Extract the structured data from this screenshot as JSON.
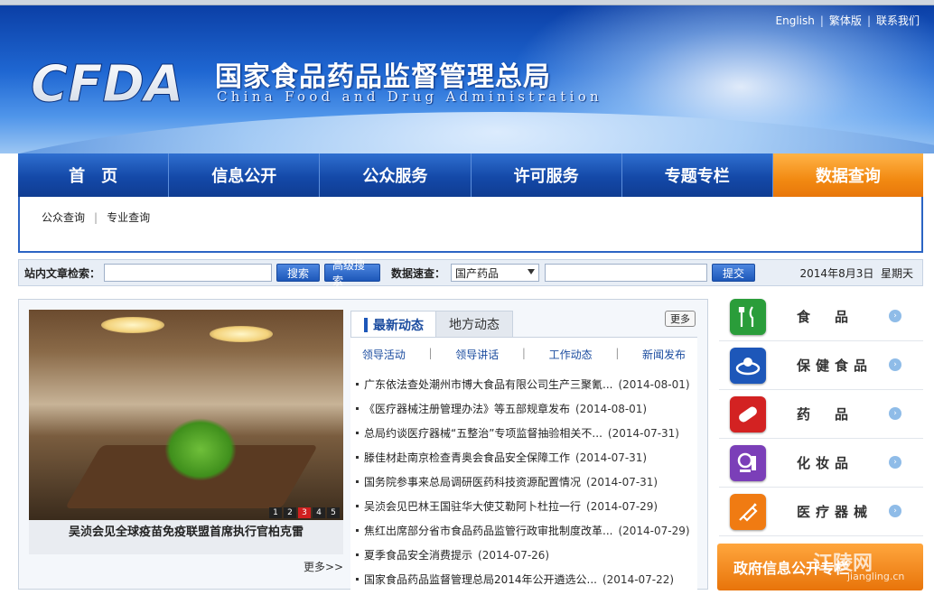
{
  "header": {
    "top_links": [
      "English",
      "繁体版",
      "联系我们"
    ],
    "logo_text": "CFDA",
    "title": "国家食品药品监督管理总局",
    "subtitle": "China Food and Drug Administration"
  },
  "nav": {
    "items": [
      "首　页",
      "信息公开",
      "公众服务",
      "许可服务",
      "专题专栏",
      "数据查询"
    ],
    "active_index": 5
  },
  "subnav": {
    "items": [
      "公众查询",
      "专业查询"
    ]
  },
  "search": {
    "article_label": "站内文章检索：",
    "article_value": "",
    "search_button": "搜索",
    "advanced_button": "高级搜索",
    "data_label": "数据速查：",
    "data_select": "国产药品",
    "data_value": "",
    "submit_button": "提交",
    "date": "2014年8月3日",
    "weekday": "星期天"
  },
  "photo": {
    "caption": "吴浈会见全球疫苗免疫联盟首席执行官柏克雷",
    "pager": [
      "1",
      "2",
      "3",
      "4",
      "5"
    ],
    "pager_active": 2,
    "more": "更多>>"
  },
  "news": {
    "tabs": [
      "最新动态",
      "地方动态"
    ],
    "more": "更多",
    "subtabs": [
      "领导活动",
      "领导讲话",
      "工作动态",
      "新闻发布"
    ],
    "items": [
      {
        "title": "广东依法查处潮州市博大食品有限公司生产三聚氰...",
        "date": "(2014-08-01)"
      },
      {
        "title": "《医疗器械注册管理办法》等五部规章发布",
        "date": "(2014-08-01)"
      },
      {
        "title": "总局约谈医疗器械“五整治”专项监督抽验相关不...",
        "date": "(2014-07-31)"
      },
      {
        "title": "滕佳材赴南京检查青奥会食品安全保障工作",
        "date": "(2014-07-31)"
      },
      {
        "title": "国务院参事来总局调研医药科技资源配置情况",
        "date": "(2014-07-31)"
      },
      {
        "title": "吴浈会见巴林王国驻华大使艾勒阿卜杜拉一行",
        "date": "(2014-07-29)"
      },
      {
        "title": "焦红出席部分省市食品药品监管行政审批制度改革...",
        "date": "(2014-07-29)"
      },
      {
        "title": "夏季食品安全消费提示",
        "date": "(2014-07-26)"
      },
      {
        "title": "国家食品药品监督管理总局2014年公开遴选公...",
        "date": "(2014-07-22)"
      }
    ]
  },
  "categories": [
    {
      "label": "食　品",
      "icon": "fork-knife-icon",
      "color": "#2a9d3a"
    },
    {
      "label": "保健食品",
      "icon": "health-food-icon",
      "color": "#1d57b9"
    },
    {
      "label": "药　品",
      "icon": "pill-icon",
      "color": "#d32222"
    },
    {
      "label": "化妆品",
      "icon": "cosmetics-icon",
      "color": "#7b3fb8"
    },
    {
      "label": "医疗器械",
      "icon": "syringe-icon",
      "color": "#f07b12"
    }
  ],
  "gov_banner": "政府信息公开专栏",
  "watermark": {
    "text": "江陵网",
    "url": "jiangling.cn"
  }
}
